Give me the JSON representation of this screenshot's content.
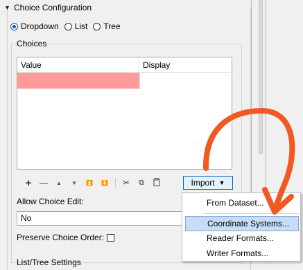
{
  "section": {
    "title": "Choice Configuration",
    "collapse_glyph": "▼"
  },
  "display_mode": {
    "options": [
      "Dropdown",
      "List",
      "Tree"
    ],
    "selected": "Dropdown"
  },
  "choices": {
    "label": "Choices",
    "columns": [
      "Value",
      "Display"
    ],
    "rows": [
      {
        "value": "",
        "display": ""
      }
    ]
  },
  "toolbar": {
    "add": "+",
    "remove": "—",
    "move_up": "▲",
    "move_down": "▼",
    "move_top": "⏫",
    "move_bottom": "⏬",
    "cut": "✂",
    "copy": "⧉",
    "paste": "📋",
    "import_label": "Import",
    "import_glyph": "▼"
  },
  "allow_choice_edit": {
    "label": "Allow Choice Edit:",
    "value": "No"
  },
  "preserve_order": {
    "label": "Preserve Choice Order:",
    "checked": false
  },
  "list_tree": {
    "label": "List/Tree Settings"
  },
  "import_menu": {
    "items": [
      "From Dataset...",
      "Coordinate Systems...",
      "Reader Formats...",
      "Writer Formats..."
    ],
    "highlighted": "Coordinate Systems..."
  },
  "colors": {
    "invalid_cell": "#fd9a9a",
    "annotation_arrow": "#f05a22",
    "accent": "#0a5fb4",
    "menu_highlight": "#c7dcf5"
  }
}
